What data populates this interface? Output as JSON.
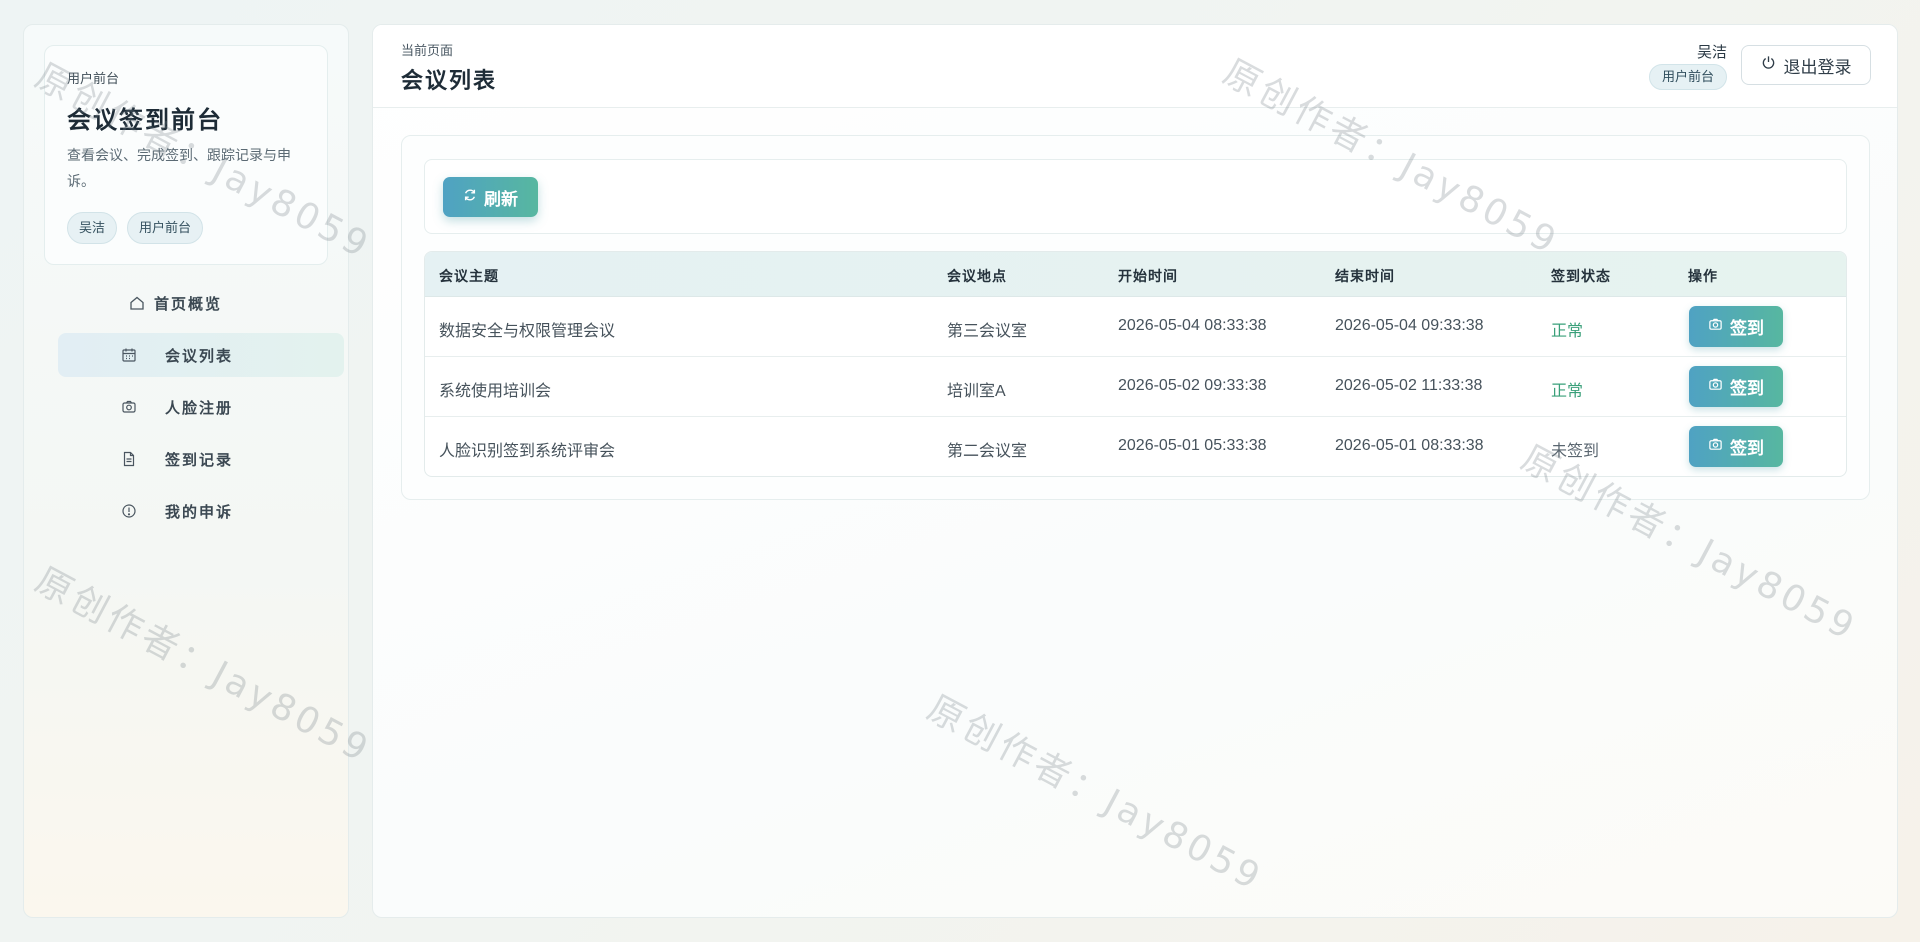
{
  "sidebar": {
    "brand_sub": "用户前台",
    "brand_title": "会议签到前台",
    "brand_desc": "查看会议、完成签到、跟踪记录与申诉。",
    "tags": [
      "吴洁",
      "用户前台"
    ],
    "items": [
      {
        "label": "首页概览",
        "icon": "home-icon"
      },
      {
        "label": "会议列表",
        "icon": "calendar-icon",
        "active": true
      },
      {
        "label": "人脸注册",
        "icon": "camera-icon"
      },
      {
        "label": "签到记录",
        "icon": "document-icon"
      },
      {
        "label": "我的申诉",
        "icon": "alert-circle-icon"
      }
    ]
  },
  "header": {
    "crumb": "当前页面",
    "title": "会议列表",
    "user_name": "吴洁",
    "role": "用户前台",
    "logout_label": "退出登录"
  },
  "toolbar": {
    "refresh_label": "刷新"
  },
  "table": {
    "columns": [
      "会议主题",
      "会议地点",
      "开始时间",
      "结束时间",
      "签到状态",
      "操作"
    ],
    "rows": [
      {
        "topic": "数据安全与权限管理会议",
        "location": "第三会议室",
        "start": "2026-05-04 08:33:38",
        "end": "2026-05-04 09:33:38",
        "status": "正常",
        "action": "签到"
      },
      {
        "topic": "系统使用培训会",
        "location": "培训室A",
        "start": "2026-05-02 09:33:38",
        "end": "2026-05-02 11:33:38",
        "status": "正常",
        "action": "签到"
      },
      {
        "topic": "人脸识别签到系统评审会",
        "location": "第二会议室",
        "start": "2026-05-01 05:33:38",
        "end": "2026-05-01 08:33:38",
        "status": "未签到",
        "action": "签到"
      }
    ]
  },
  "watermark": "原创作者：Jay8059",
  "colors": {
    "accent_start": "#4fa2c3",
    "accent_end": "#57b7a0",
    "status_ok": "#3aa07a"
  }
}
